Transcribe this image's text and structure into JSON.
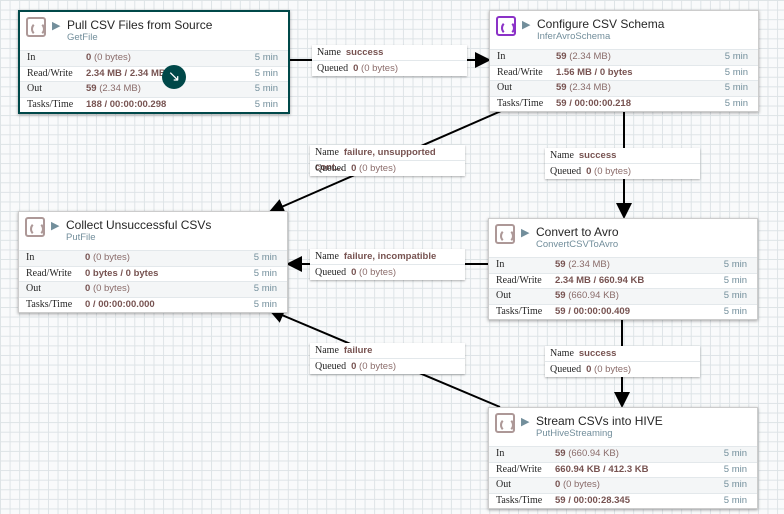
{
  "processors": [
    {
      "name": "Pull CSV Files from Source",
      "type": "GetFile",
      "icon": "processor-icon",
      "rows": [
        {
          "label": "In",
          "value": "0",
          "unit": "(0 bytes)",
          "time": "5 min"
        },
        {
          "label": "Read/Write",
          "value": "2.34 MB / 2.34 MB",
          "unit": "",
          "time": "5 min"
        },
        {
          "label": "Out",
          "value": "59",
          "unit": "(2.34 MB)",
          "time": "5 min"
        },
        {
          "label": "Tasks/Time",
          "value": "188 / 00:00:00.298",
          "unit": "",
          "time": "5 min"
        }
      ]
    },
    {
      "name": "Configure CSV Schema",
      "type": "InferAvroSchema",
      "icon": "processor-icon",
      "rows": [
        {
          "label": "In",
          "value": "59",
          "unit": "(2.34 MB)",
          "time": "5 min"
        },
        {
          "label": "Read/Write",
          "value": "1.56 MB / 0 bytes",
          "unit": "",
          "time": "5 min"
        },
        {
          "label": "Out",
          "value": "59",
          "unit": "(2.34 MB)",
          "time": "5 min"
        },
        {
          "label": "Tasks/Time",
          "value": "59 / 00:00:00.218",
          "unit": "",
          "time": "5 min"
        }
      ]
    },
    {
      "name": "Collect Unsuccessful CSVs",
      "type": "PutFile",
      "icon": "processor-icon",
      "rows": [
        {
          "label": "In",
          "value": "0",
          "unit": "(0 bytes)",
          "time": "5 min"
        },
        {
          "label": "Read/Write",
          "value": "0 bytes / 0 bytes",
          "unit": "",
          "time": "5 min"
        },
        {
          "label": "Out",
          "value": "0",
          "unit": "(0 bytes)",
          "time": "5 min"
        },
        {
          "label": "Tasks/Time",
          "value": "0 / 00:00:00.000",
          "unit": "",
          "time": "5 min"
        }
      ]
    },
    {
      "name": "Convert to Avro",
      "type": "ConvertCSVToAvro",
      "icon": "processor-icon",
      "rows": [
        {
          "label": "In",
          "value": "59",
          "unit": "(2.34 MB)",
          "time": "5 min"
        },
        {
          "label": "Read/Write",
          "value": "2.34 MB / 660.94 KB",
          "unit": "",
          "time": "5 min"
        },
        {
          "label": "Out",
          "value": "59",
          "unit": "(660.94 KB)",
          "time": "5 min"
        },
        {
          "label": "Tasks/Time",
          "value": "59 / 00:00:00.409",
          "unit": "",
          "time": "5 min"
        }
      ]
    },
    {
      "name": "Stream CSVs into HIVE",
      "type": "PutHiveStreaming",
      "icon": "processor-icon",
      "rows": [
        {
          "label": "In",
          "value": "59",
          "unit": "(660.94 KB)",
          "time": "5 min"
        },
        {
          "label": "Read/Write",
          "value": "660.94 KB / 412.3 KB",
          "unit": "",
          "time": "5 min"
        },
        {
          "label": "Out",
          "value": "0",
          "unit": "(0 bytes)",
          "time": "5 min"
        },
        {
          "label": "Tasks/Time",
          "value": "59 / 00:00:28.345",
          "unit": "",
          "time": "5 min"
        }
      ]
    }
  ],
  "connections": [
    {
      "name_label": "Name",
      "name": "success",
      "queued_label": "Queued",
      "count": "0",
      "size": "(0 bytes)"
    },
    {
      "name_label": "Name",
      "name": "failure, unsupported cont...",
      "queued_label": "Queued",
      "count": "0",
      "size": "(0 bytes)"
    },
    {
      "name_label": "Name",
      "name": "success",
      "queued_label": "Queued",
      "count": "0",
      "size": "(0 bytes)"
    },
    {
      "name_label": "Name",
      "name": "failure, incompatible",
      "queued_label": "Queued",
      "count": "0",
      "size": "(0 bytes)"
    },
    {
      "name_label": "Name",
      "name": "success",
      "queued_label": "Queued",
      "count": "0",
      "size": "(0 bytes)"
    },
    {
      "name_label": "Name",
      "name": "failure",
      "queued_label": "Queued",
      "count": "0",
      "size": "(0 bytes)"
    }
  ],
  "colors": {
    "selected_border": "#004849",
    "value": "#775351",
    "muted": "#728e9b"
  }
}
